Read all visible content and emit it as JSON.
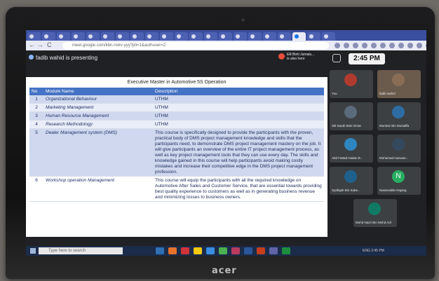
{
  "browser": {
    "url": "meet.google.com/kbn-nxkv-yyy?pli=1&authuser=2",
    "nav_back": "←",
    "nav_forward": "→",
    "nav_reload": "C"
  },
  "meet": {
    "presenting_label": "fadib wahid is presenting",
    "also_here_name": "Elli Binti Jamalu...",
    "also_here_label": "is also here",
    "clock": "2:45 PM"
  },
  "slide": {
    "title": "Executive Master in Automotive 5S Operation",
    "columns": [
      "No",
      "Module Name",
      "Description"
    ],
    "rows": [
      {
        "no": "1",
        "name": "Organizational Behaviour",
        "desc": "UTHM"
      },
      {
        "no": "2",
        "name": "Marketing Management",
        "desc": "UTHM"
      },
      {
        "no": "3",
        "name": "Human Resource Management",
        "desc": "UTHM"
      },
      {
        "no": "4",
        "name": "Research Methodology",
        "desc": "UTHM"
      },
      {
        "no": "5",
        "name": "Dealer Management system (DMS)",
        "desc": "This course is specifically designed to provide the participants with the proven, practical body of DMS project management knowledge and skills that the participants need, to demonstrate DMS project management mastery on the job. It will give participants an overview of the entire IT project management process, as well as key project management tools that they can use every day. The skills and knowledge gained in this course will help participants avoid making costly mistakes and increase their competitive edge in the DMS project management profession."
      },
      {
        "no": "6",
        "name": "Workshop operation Management",
        "desc": "This course will equip the participants with all the required knowledge on Automotive After Sales and Customer Service, that are essential towards providing best quality experience to customers as well as in generating business revenue and minimizing losses to business owners."
      }
    ]
  },
  "participants": [
    {
      "name": "You",
      "color": "#b03a2e"
    },
    {
      "name": "fadib wahid",
      "color": "#6b5b4d"
    },
    {
      "name": "Siti Sarah Binti Omar",
      "color": "#5b6b7b"
    },
    {
      "name": "Mumtaz Bin Mustaffa",
      "color": "#2e6da4"
    },
    {
      "name": "Abd Fattad Hadan B...",
      "color": "#2e86c1"
    },
    {
      "name": "Mohamad Hazwan...",
      "color": "#34495e"
    },
    {
      "name": "Syafiqah Bin Sube...",
      "color": "#1f618d"
    },
    {
      "name": "Nasaruddin Raping",
      "color": "#27ae60"
    },
    {
      "name": "Mohd Nazri Bin Mohd Adi",
      "color": "#117a65"
    }
  ],
  "participant_initial_n": "N",
  "taskbar": {
    "search_placeholder": "Type here to search",
    "tray_text": "ENG 2:45 PM"
  },
  "brand": "acer"
}
